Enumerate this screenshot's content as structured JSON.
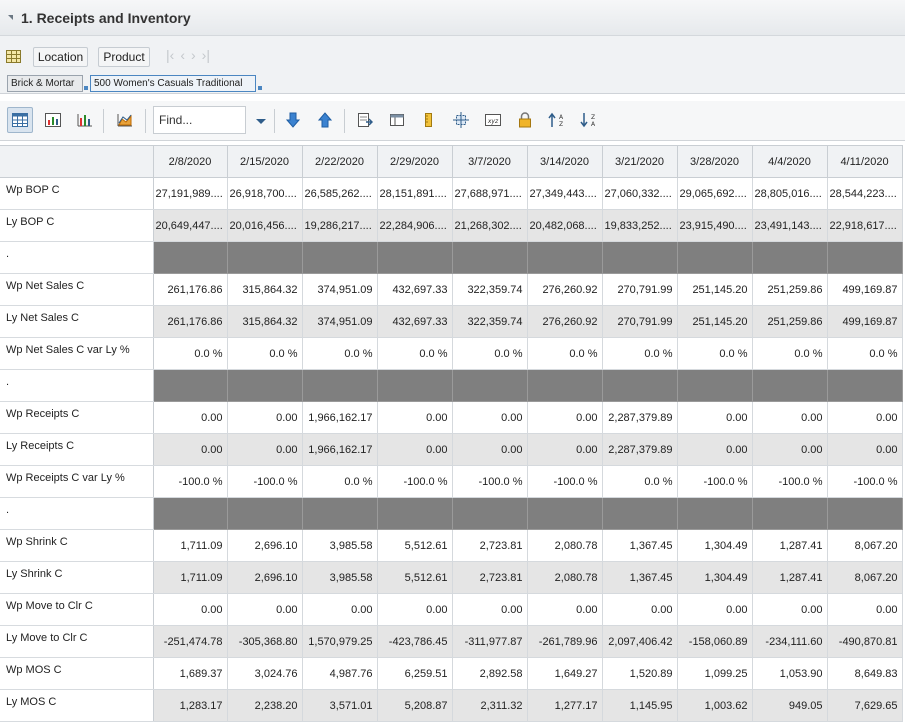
{
  "panel": {
    "title": "1. Receipts and Inventory"
  },
  "dims": {
    "location_label": "Location",
    "product_label": "Product"
  },
  "chips": {
    "location_value": "Brick & Mortar",
    "product_value": "500 Women's Casuals Traditional"
  },
  "toolbar": {
    "find_placeholder": "Find..."
  },
  "grid": {
    "columns": [
      "2/8/2020",
      "2/15/2020",
      "2/22/2020",
      "2/29/2020",
      "3/7/2020",
      "3/14/2020",
      "3/21/2020",
      "3/28/2020",
      "4/4/2020",
      "4/11/2020"
    ],
    "rows": [
      {
        "label": "Wp BOP C",
        "style": "bop-w",
        "values": [
          "27,191,989....",
          "26,918,700....",
          "26,585,262....",
          "28,151,891....",
          "27,688,971....",
          "27,349,443....",
          "27,060,332....",
          "29,065,692....",
          "28,805,016....",
          "28,544,223...."
        ]
      },
      {
        "label": "Ly BOP C",
        "style": "bop-g",
        "values": [
          "20,649,447....",
          "20,016,456....",
          "19,286,217....",
          "22,284,906....",
          "21,268,302....",
          "20,482,068....",
          "19,833,252....",
          "23,915,490....",
          "23,491,143....",
          "22,918,617...."
        ]
      },
      {
        "label": ".",
        "style": "d",
        "values": [
          "",
          "",
          "",
          "",
          "",
          "",
          "",
          "",
          "",
          ""
        ]
      },
      {
        "label": "Wp Net Sales C",
        "style": "w",
        "values": [
          "261,176.86",
          "315,864.32",
          "374,951.09",
          "432,697.33",
          "322,359.74",
          "276,260.92",
          "270,791.99",
          "251,145.20",
          "251,259.86",
          "499,169.87"
        ]
      },
      {
        "label": "Ly Net Sales C",
        "style": "g",
        "values": [
          "261,176.86",
          "315,864.32",
          "374,951.09",
          "432,697.33",
          "322,359.74",
          "276,260.92",
          "270,791.99",
          "251,145.20",
          "251,259.86",
          "499,169.87"
        ]
      },
      {
        "label": "Wp Net Sales C var Ly %",
        "style": "w",
        "values": [
          "0.0 %",
          "0.0 %",
          "0.0 %",
          "0.0 %",
          "0.0 %",
          "0.0 %",
          "0.0 %",
          "0.0 %",
          "0.0 %",
          "0.0 %"
        ]
      },
      {
        "label": ".",
        "style": "d",
        "values": [
          "",
          "",
          "",
          "",
          "",
          "",
          "",
          "",
          "",
          ""
        ]
      },
      {
        "label": "Wp Receipts C",
        "style": "w",
        "values": [
          "0.00",
          "0.00",
          "1,966,162.17",
          "0.00",
          "0.00",
          "0.00",
          "2,287,379.89",
          "0.00",
          "0.00",
          "0.00"
        ]
      },
      {
        "label": "Ly Receipts C",
        "style": "g",
        "values": [
          "0.00",
          "0.00",
          "1,966,162.17",
          "0.00",
          "0.00",
          "0.00",
          "2,287,379.89",
          "0.00",
          "0.00",
          "0.00"
        ]
      },
      {
        "label": "Wp Receipts C var Ly %",
        "style": "w",
        "values": [
          "-100.0 %",
          "-100.0 %",
          "0.0 %",
          "-100.0 %",
          "-100.0 %",
          "-100.0 %",
          "0.0 %",
          "-100.0 %",
          "-100.0 %",
          "-100.0 %"
        ]
      },
      {
        "label": ".",
        "style": "d",
        "values": [
          "",
          "",
          "",
          "",
          "",
          "",
          "",
          "",
          "",
          ""
        ]
      },
      {
        "label": "Wp Shrink C",
        "style": "w",
        "values": [
          "1,711.09",
          "2,696.10",
          "3,985.58",
          "5,512.61",
          "2,723.81",
          "2,080.78",
          "1,367.45",
          "1,304.49",
          "1,287.41",
          "8,067.20"
        ]
      },
      {
        "label": "Ly Shrink C",
        "style": "g",
        "values": [
          "1,711.09",
          "2,696.10",
          "3,985.58",
          "5,512.61",
          "2,723.81",
          "2,080.78",
          "1,367.45",
          "1,304.49",
          "1,287.41",
          "8,067.20"
        ]
      },
      {
        "label": "Wp Move to Clr C",
        "style": "w",
        "values": [
          "0.00",
          "0.00",
          "0.00",
          "0.00",
          "0.00",
          "0.00",
          "0.00",
          "0.00",
          "0.00",
          "0.00"
        ]
      },
      {
        "label": "Ly Move to Clr C",
        "style": "g",
        "values": [
          "-251,474.78",
          "-305,368.80",
          "1,570,979.25",
          "-423,786.45",
          "-311,977.87",
          "-261,789.96",
          "2,097,406.42",
          "-158,060.89",
          "-234,111.60",
          "-490,870.81"
        ]
      },
      {
        "label": "Wp MOS C",
        "style": "w",
        "values": [
          "1,689.37",
          "3,024.76",
          "4,987.76",
          "6,259.51",
          "2,892.58",
          "1,649.27",
          "1,520.89",
          "1,099.25",
          "1,053.90",
          "8,649.83"
        ]
      },
      {
        "label": "Ly MOS C",
        "style": "g",
        "values": [
          "1,283.17",
          "2,238.20",
          "3,571.01",
          "5,208.87",
          "2,311.32",
          "1,277.17",
          "1,145.95",
          "1,003.62",
          "949.05",
          "7,629.65"
        ]
      }
    ]
  }
}
